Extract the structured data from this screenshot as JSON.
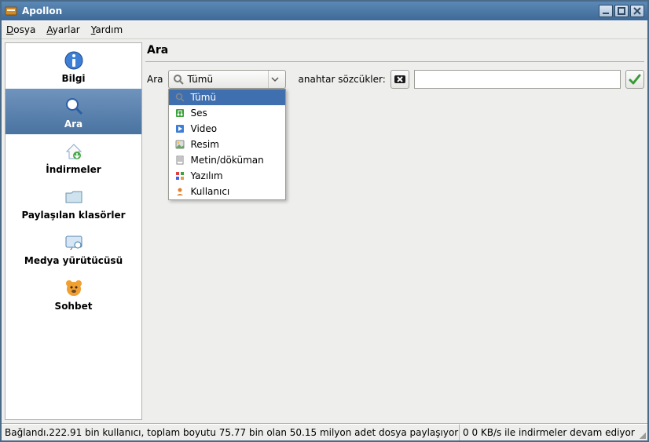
{
  "window": {
    "title": "Apollon"
  },
  "menubar": {
    "items": [
      {
        "label": "Dosya",
        "accel_pos": 0
      },
      {
        "label": "Ayarlar",
        "accel_pos": 0
      },
      {
        "label": "Yardım",
        "accel_pos": 0
      }
    ]
  },
  "sidebar": {
    "items": [
      {
        "icon": "info",
        "label": "Bilgi"
      },
      {
        "icon": "search",
        "label": "Ara"
      },
      {
        "icon": "home-down",
        "label": "İndirmeler"
      },
      {
        "icon": "folder",
        "label": "Paylaşılan klasörler"
      },
      {
        "icon": "media",
        "label": "Medya yürütücüsü"
      },
      {
        "icon": "bear",
        "label": "Sohbet"
      }
    ],
    "selected_index": 1
  },
  "main": {
    "heading": "Ara",
    "search": {
      "label": "Ara",
      "keywords_label": "anahtar sözcükler:",
      "input_value": "",
      "dropdown": {
        "selected_label": "Tümü",
        "options": [
          {
            "icon": "search",
            "label": "Tümü"
          },
          {
            "icon": "audio",
            "label": "Ses"
          },
          {
            "icon": "video",
            "label": "Video"
          },
          {
            "icon": "image",
            "label": "Resim"
          },
          {
            "icon": "text",
            "label": "Metin/döküman"
          },
          {
            "icon": "software",
            "label": "Yazılım"
          },
          {
            "icon": "user",
            "label": "Kullanıcı"
          }
        ],
        "selected_index": 0
      }
    }
  },
  "statusbar": {
    "left": "Bağlandı.222.91 bin kullanıcı, toplam boyutu 75.77 bin olan 50.15 milyon adet dosya paylaşıyor",
    "right": "0 0 KB/s ile indirmeler devam ediyor"
  }
}
